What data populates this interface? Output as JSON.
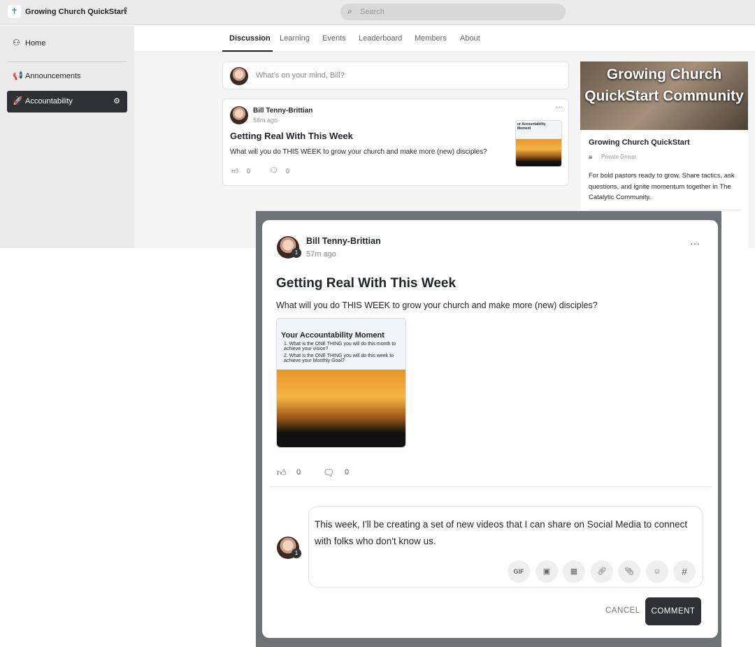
{
  "app": {
    "title": "Growing Church QuickStart",
    "search_placeholder": "Search"
  },
  "sidebar": {
    "items": [
      {
        "label": "Home",
        "icon": "users-icon"
      },
      {
        "label": "Announcements",
        "icon": "megaphone-icon"
      },
      {
        "label": "Accountability",
        "icon": "rocket-icon",
        "active": true
      }
    ]
  },
  "tabs": [
    "Discussion",
    "Learning",
    "Events",
    "Leaderboard",
    "Members",
    "About"
  ],
  "composer": {
    "placeholder": "What's on your mind, Bill?"
  },
  "post": {
    "author": "Bill Tenny-Brittian",
    "time": "58m ago",
    "title": "Getting Real With This Week",
    "body": "What will you do THIS WEEK to grow your church and make more (new) disciples?",
    "likes": "0",
    "comments": "0",
    "thumb_title": "ur Accountability Moment",
    "badge": "1"
  },
  "group": {
    "banner": "Growing Church QuickStart Community",
    "name": "Growing Church QuickStart",
    "privacy": "Private Group",
    "description": "For bold pastors ready to grow. Share tactics, ask questions, and ignite momentum together in The Catalytic Community."
  },
  "modal": {
    "author": "Bill Tenny-Brittian",
    "time": "57m ago",
    "badge": "1",
    "title": "Getting Real With This Week",
    "body": "What will you do THIS WEEK to grow your church and make more (new) disciples?",
    "image": {
      "title": "Your Accountability Moment",
      "q1": "1. What is the ONE THING you will do this month to achieve your vision?",
      "q2": "2. What is the ONE THING you will do this week to achieve your Monthly Goal?"
    },
    "likes": "0",
    "comments": "0",
    "comment_text": "This week, I'll be creating a set of new videos that I can share on Social Media to connect with folks who don't know us.",
    "gif_label": "GIF",
    "hash_label": "#",
    "cancel": "CANCEL",
    "submit": "COMMENT"
  }
}
